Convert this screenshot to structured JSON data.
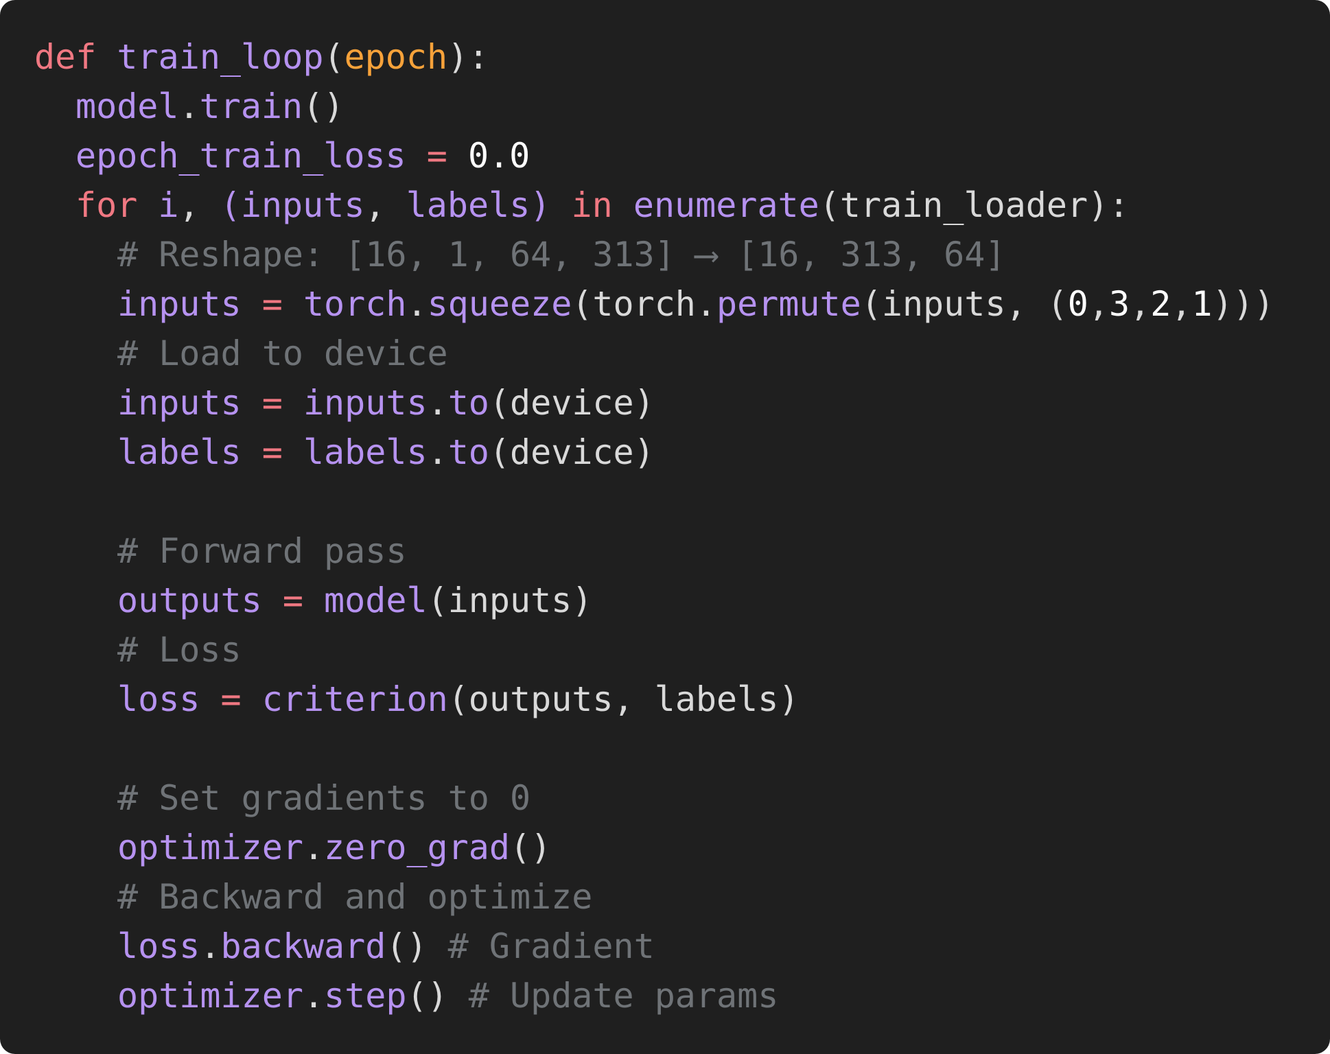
{
  "colors": {
    "background": "#1f1f1f",
    "keyword": "#f07882",
    "identifier": "#b692f0",
    "parameter": "#f7a23a",
    "number": "#ffffff",
    "comment": "#6f7377",
    "plain": "#d9d9d9"
  },
  "code": {
    "language": "python",
    "lines": [
      {
        "indent": 0,
        "tokens": [
          {
            "t": "keyword",
            "v": "def"
          },
          {
            "t": "plain",
            "v": " "
          },
          {
            "t": "ident",
            "v": "train_loop"
          },
          {
            "t": "punct",
            "v": "("
          },
          {
            "t": "param",
            "v": "epoch"
          },
          {
            "t": "punct",
            "v": "):"
          }
        ]
      },
      {
        "indent": 1,
        "tokens": [
          {
            "t": "ident",
            "v": "model"
          },
          {
            "t": "punct",
            "v": "."
          },
          {
            "t": "ident",
            "v": "train"
          },
          {
            "t": "punct",
            "v": "()"
          }
        ]
      },
      {
        "indent": 1,
        "tokens": [
          {
            "t": "ident",
            "v": "epoch_train_loss"
          },
          {
            "t": "plain",
            "v": " "
          },
          {
            "t": "op",
            "v": "="
          },
          {
            "t": "plain",
            "v": " "
          },
          {
            "t": "number",
            "v": "0.0"
          }
        ]
      },
      {
        "indent": 1,
        "tokens": [
          {
            "t": "keyword",
            "v": "for"
          },
          {
            "t": "plain",
            "v": " "
          },
          {
            "t": "ident",
            "v": "i"
          },
          {
            "t": "punct",
            "v": ", "
          },
          {
            "t": "ident",
            "v": "(inputs"
          },
          {
            "t": "punct",
            "v": ", "
          },
          {
            "t": "ident",
            "v": "labels)"
          },
          {
            "t": "plain",
            "v": " "
          },
          {
            "t": "keyword",
            "v": "in"
          },
          {
            "t": "plain",
            "v": " "
          },
          {
            "t": "ident",
            "v": "enumerate"
          },
          {
            "t": "punct",
            "v": "(train_loader):"
          }
        ]
      },
      {
        "indent": 2,
        "tokens": [
          {
            "t": "comment",
            "v": "# Reshape: [16, 1, 64, 313] ⟶ [16, 313, 64]"
          }
        ]
      },
      {
        "indent": 2,
        "tokens": [
          {
            "t": "ident",
            "v": "inputs"
          },
          {
            "t": "plain",
            "v": " "
          },
          {
            "t": "op",
            "v": "="
          },
          {
            "t": "plain",
            "v": " "
          },
          {
            "t": "ident",
            "v": "torch"
          },
          {
            "t": "punct",
            "v": "."
          },
          {
            "t": "ident",
            "v": "squeeze"
          },
          {
            "t": "punct",
            "v": "(torch."
          },
          {
            "t": "ident",
            "v": "permute"
          },
          {
            "t": "punct",
            "v": "(inputs, ("
          },
          {
            "t": "number",
            "v": "0"
          },
          {
            "t": "punct",
            "v": ","
          },
          {
            "t": "number",
            "v": "3"
          },
          {
            "t": "punct",
            "v": ","
          },
          {
            "t": "number",
            "v": "2"
          },
          {
            "t": "punct",
            "v": ","
          },
          {
            "t": "number",
            "v": "1"
          },
          {
            "t": "punct",
            "v": ")))"
          }
        ]
      },
      {
        "indent": 2,
        "tokens": [
          {
            "t": "comment",
            "v": "# Load to device"
          }
        ]
      },
      {
        "indent": 2,
        "tokens": [
          {
            "t": "ident",
            "v": "inputs"
          },
          {
            "t": "plain",
            "v": " "
          },
          {
            "t": "op",
            "v": "="
          },
          {
            "t": "plain",
            "v": " "
          },
          {
            "t": "ident",
            "v": "inputs"
          },
          {
            "t": "punct",
            "v": "."
          },
          {
            "t": "ident",
            "v": "to"
          },
          {
            "t": "punct",
            "v": "(device)"
          }
        ]
      },
      {
        "indent": 2,
        "tokens": [
          {
            "t": "ident",
            "v": "labels"
          },
          {
            "t": "plain",
            "v": " "
          },
          {
            "t": "op",
            "v": "="
          },
          {
            "t": "plain",
            "v": " "
          },
          {
            "t": "ident",
            "v": "labels"
          },
          {
            "t": "punct",
            "v": "."
          },
          {
            "t": "ident",
            "v": "to"
          },
          {
            "t": "punct",
            "v": "(device)"
          }
        ]
      },
      {
        "indent": 0,
        "tokens": []
      },
      {
        "indent": 2,
        "tokens": [
          {
            "t": "comment",
            "v": "# Forward pass"
          }
        ]
      },
      {
        "indent": 2,
        "tokens": [
          {
            "t": "ident",
            "v": "outputs"
          },
          {
            "t": "plain",
            "v": " "
          },
          {
            "t": "op",
            "v": "="
          },
          {
            "t": "plain",
            "v": " "
          },
          {
            "t": "ident",
            "v": "model"
          },
          {
            "t": "punct",
            "v": "(inputs)"
          }
        ]
      },
      {
        "indent": 2,
        "tokens": [
          {
            "t": "comment",
            "v": "# Loss"
          }
        ]
      },
      {
        "indent": 2,
        "tokens": [
          {
            "t": "ident",
            "v": "loss"
          },
          {
            "t": "plain",
            "v": " "
          },
          {
            "t": "op",
            "v": "="
          },
          {
            "t": "plain",
            "v": " "
          },
          {
            "t": "ident",
            "v": "criterion"
          },
          {
            "t": "punct",
            "v": "(outputs, labels)"
          }
        ]
      },
      {
        "indent": 0,
        "tokens": []
      },
      {
        "indent": 2,
        "tokens": [
          {
            "t": "comment",
            "v": "# Set gradients to 0"
          }
        ]
      },
      {
        "indent": 2,
        "tokens": [
          {
            "t": "ident",
            "v": "optimizer"
          },
          {
            "t": "punct",
            "v": "."
          },
          {
            "t": "ident",
            "v": "zero_grad"
          },
          {
            "t": "punct",
            "v": "()"
          }
        ]
      },
      {
        "indent": 2,
        "tokens": [
          {
            "t": "comment",
            "v": "# Backward and optimize"
          }
        ]
      },
      {
        "indent": 2,
        "tokens": [
          {
            "t": "ident",
            "v": "loss"
          },
          {
            "t": "punct",
            "v": "."
          },
          {
            "t": "ident",
            "v": "backward"
          },
          {
            "t": "punct",
            "v": "() "
          },
          {
            "t": "comment",
            "v": "# Gradient"
          }
        ]
      },
      {
        "indent": 2,
        "tokens": [
          {
            "t": "ident",
            "v": "optimizer"
          },
          {
            "t": "punct",
            "v": "."
          },
          {
            "t": "ident",
            "v": "step"
          },
          {
            "t": "punct",
            "v": "() "
          },
          {
            "t": "comment",
            "v": "# Update params"
          }
        ]
      }
    ]
  }
}
